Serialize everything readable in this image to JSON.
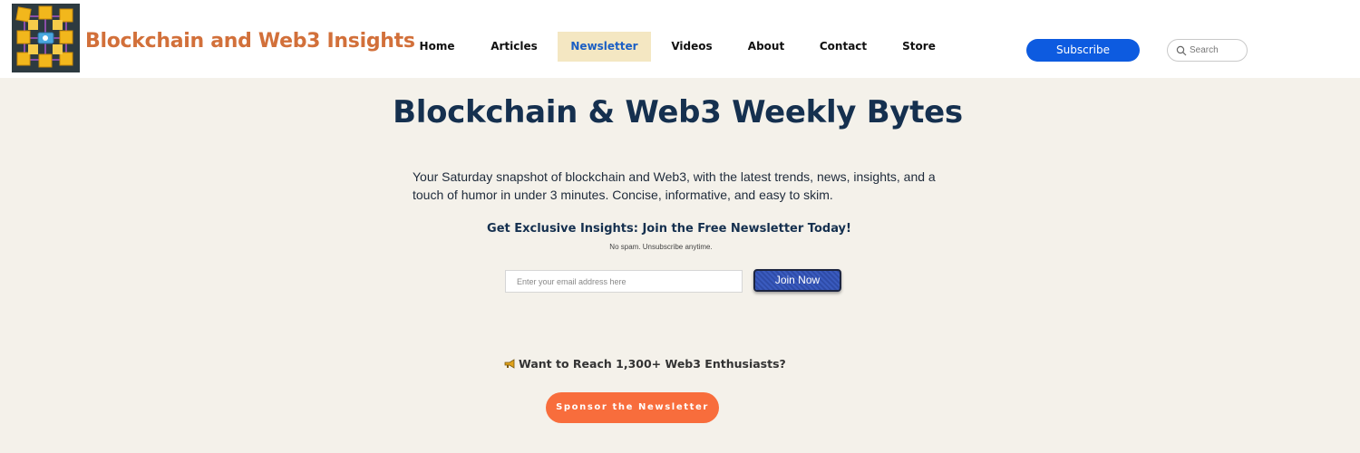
{
  "header": {
    "site_title": "Blockchain and Web3 Insights",
    "logo_icon": "blockchain-cubes-logo",
    "nav": [
      {
        "label": "Home",
        "active": false
      },
      {
        "label": "Articles",
        "active": false
      },
      {
        "label": "Newsletter",
        "active": true
      },
      {
        "label": "Videos",
        "active": false
      },
      {
        "label": "About",
        "active": false
      },
      {
        "label": "Contact",
        "active": false
      },
      {
        "label": "Store",
        "active": false
      }
    ],
    "subscribe_label": "Subscribe",
    "search_placeholder": "Search"
  },
  "main": {
    "title": "Blockchain & Web3 Weekly Bytes",
    "intro_line1": "Your Saturday snapshot of blockchain and Web3, with the latest trends, news, insights, and a",
    "intro_line2": "touch of humor in under 3 minutes. Concise, informative, and easy to skim.",
    "cta_heading": "Get Exclusive Insights: Join the Free Newsletter Today!",
    "cta_sub": "No spam. Unsubscribe anytime.",
    "email_placeholder": "Enter your email address here",
    "join_label": "Join Now",
    "reach_text": "Want to Reach 1,300+ Web3 Enthusiasts?",
    "reach_icon": "megaphone-icon",
    "sponsor_label": "Sponsor the Newsletter"
  },
  "colors": {
    "page_bg": "#f4f1ea",
    "title_orange": "#d2703a",
    "navy": "#15304f",
    "active_nav_bg": "#f4e7c2",
    "active_nav_text": "#1b5fc4",
    "subscribe_blue": "#0d5be0",
    "sponsor_orange": "#f86d3c"
  }
}
